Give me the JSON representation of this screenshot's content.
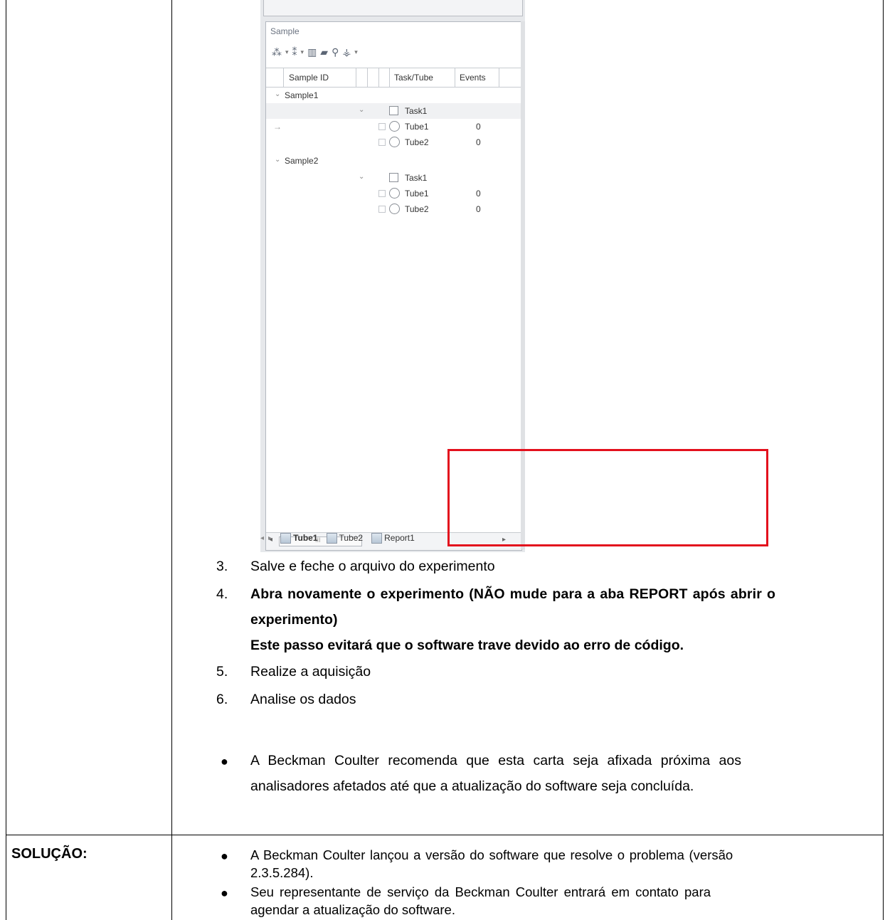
{
  "screenshot": {
    "panel_title": "Sample",
    "columns": [
      "Sample ID",
      "Task/Tube",
      "Events"
    ],
    "rows": [
      {
        "sample": "Sample1",
        "tasks": [
          {
            "task": "Task1",
            "tubes": [
              {
                "name": "Tube1",
                "events": "0"
              },
              {
                "name": "Tube2",
                "events": "0"
              }
            ]
          }
        ]
      },
      {
        "sample": "Sample2",
        "tasks": [
          {
            "task": "Task1",
            "tubes": [
              {
                "name": "Tube1",
                "events": "0"
              },
              {
                "name": "Tube2",
                "events": "0"
              }
            ]
          }
        ]
      }
    ],
    "scroll_thumb_glyph": "III",
    "tabs": [
      "Tube1",
      "Tube2",
      "Report1"
    ],
    "highlight_color": "#e3101d"
  },
  "steps": [
    {
      "num": "3.",
      "text": "Salve e feche o arquivo do experimento"
    },
    {
      "num": "4.",
      "text_line1": "Abra novamente o experimento (NÃO mude para a aba REPORT após abrir o",
      "text_line2": "experimento)",
      "note": "Este passo evitará que o software trave devido ao erro de código."
    },
    {
      "num": "5.",
      "text": "Realize a aquisição"
    },
    {
      "num": "6.",
      "text": "Analise os dados"
    }
  ],
  "recommendation": {
    "line1": "A Beckman Coulter recomenda que esta carta seja afixada próxima aos",
    "line2": "analisadores afetados até que a atualização do software seja concluída."
  },
  "solution": {
    "label": "SOLUÇÃO:",
    "bullets": [
      {
        "line1": "A Beckman Coulter lançou a versão do software que resolve o problema (versão",
        "line2": "2.3.5.284)."
      },
      {
        "line1": "Seu representante de serviço da Beckman Coulter entrará em contato para",
        "line2": "agendar a atualização do software."
      }
    ]
  }
}
